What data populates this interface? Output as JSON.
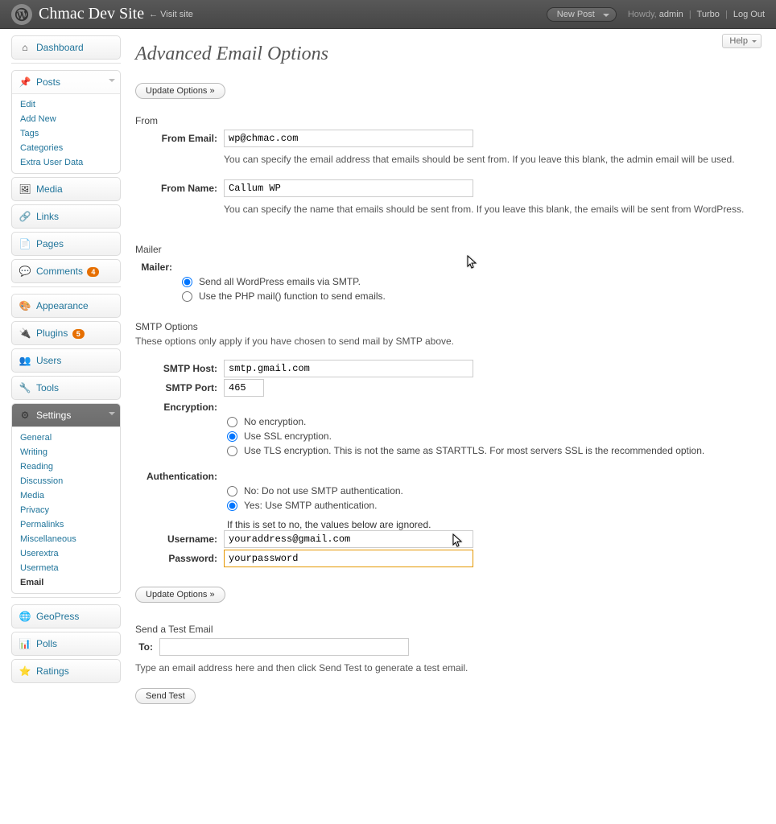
{
  "header": {
    "site_title": "Chmac Dev Site",
    "visit_site": "← Visit site",
    "new_post": "New Post",
    "howdy": "Howdy,",
    "user": "admin",
    "turbo": "Turbo",
    "logout": "Log Out"
  },
  "help_tab": "Help",
  "sidebar": {
    "dashboard": "Dashboard",
    "posts": {
      "title": "Posts",
      "items": [
        "Edit",
        "Add New",
        "Tags",
        "Categories",
        "Extra User Data"
      ]
    },
    "media": "Media",
    "links": "Links",
    "pages": "Pages",
    "comments": "Comments",
    "comments_count": "4",
    "appearance": "Appearance",
    "plugins": "Plugins",
    "plugins_count": "5",
    "users": "Users",
    "tools": "Tools",
    "settings": {
      "title": "Settings",
      "items": [
        "General",
        "Writing",
        "Reading",
        "Discussion",
        "Media",
        "Privacy",
        "Permalinks",
        "Miscellaneous",
        "Userextra",
        "Usermeta",
        "Email"
      ],
      "current": "Email"
    },
    "geopress": "GeoPress",
    "polls": "Polls",
    "ratings": "Ratings"
  },
  "page": {
    "title": "Advanced Email Options",
    "update_button": "Update Options »",
    "from_section": "From",
    "from_email_label": "From Email:",
    "from_email_value": "wp@chmac.com",
    "from_email_help": "You can specify the email address that emails should be sent from. If you leave this blank, the admin email will be used.",
    "from_name_label": "From Name:",
    "from_name_value": "Callum WP",
    "from_name_help": "You can specify the name that emails should be sent from. If you leave this blank, the emails will be sent from WordPress.",
    "mailer_section": "Mailer",
    "mailer_label": "Mailer:",
    "mailer_smtp": "Send all WordPress emails via SMTP.",
    "mailer_php": "Use the PHP mail() function to send emails.",
    "smtp_section": "SMTP Options",
    "smtp_section_help": "These options only apply if you have chosen to send mail by SMTP above.",
    "smtp_host_label": "SMTP Host:",
    "smtp_host_value": "smtp.gmail.com",
    "smtp_port_label": "SMTP Port:",
    "smtp_port_value": "465",
    "encryption_label": "Encryption:",
    "enc_none": "No encryption.",
    "enc_ssl": "Use SSL encryption.",
    "enc_tls": "Use TLS encryption. This is not the same as STARTTLS. For most servers SSL is the recommended option.",
    "auth_label": "Authentication:",
    "auth_no": "No: Do not use SMTP authentication.",
    "auth_yes": "Yes: Use SMTP authentication.",
    "auth_help": "If this is set to no, the values below are ignored.",
    "username_label": "Username:",
    "username_value": "youraddress@gmail.com",
    "password_label": "Password:",
    "password_value": "yourpassword",
    "test_section": "Send a Test Email",
    "test_to_label": "To:",
    "test_to_value": "",
    "test_help": "Type an email address here and then click Send Test to generate a test email.",
    "send_test": "Send Test"
  }
}
